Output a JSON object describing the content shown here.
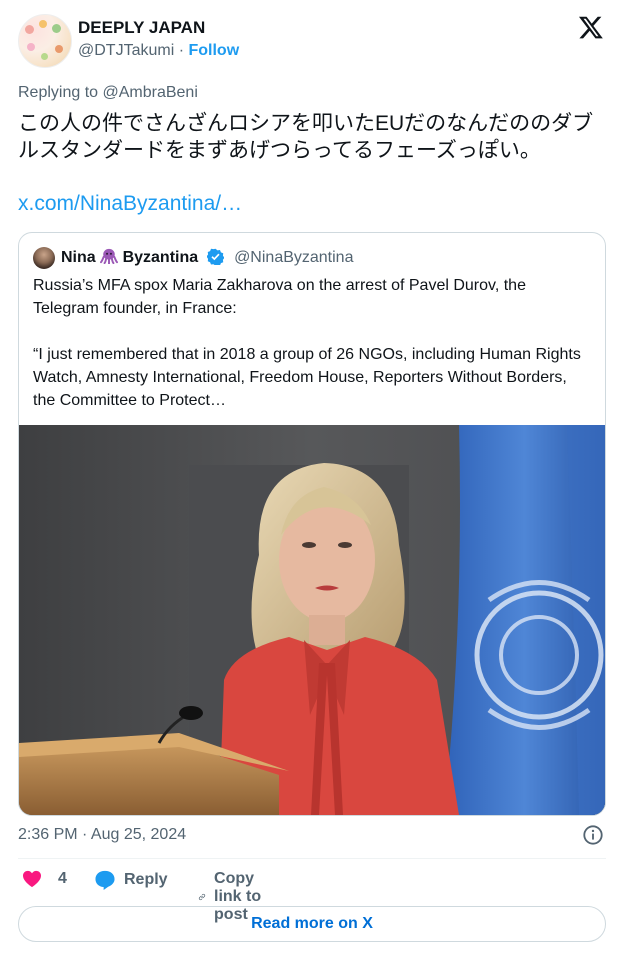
{
  "author": {
    "name": "DEEPLY JAPAN",
    "handle": "@DTJTakumi",
    "separator": "·",
    "follow_label": "Follow"
  },
  "replying_to": "Replying to @AmbraBeni",
  "tweet_text": "この人の件でさんざんロシアを叩いたEUだのなんだののダブルスタンダードをまずあげつらってるフェーズっぽい。",
  "tweet_link": "x.com/NinaByzantina/…",
  "quoted": {
    "name_first": "Nina",
    "name_last": "Byzantina",
    "handle": "@NinaByzantina",
    "paragraph1": "Russia’s MFA spox Maria Zakharova on the arrest of Pavel Durov, the Telegram founder, in France:",
    "paragraph2": "“I just remembered that in 2018 a group of 26 NGOs, including Human Rights Watch, Amnesty International, Freedom House, Reporters Without Borders, the Committee to Protect…"
  },
  "timestamp": "2:36 PM · Aug 25, 2024",
  "actions": {
    "like_count": "4",
    "reply_label": "Reply",
    "copy_label": "Copy link to post"
  },
  "read_more_label": "Read more on X",
  "colors": {
    "accent": "#1d9bf0",
    "like": "#f91880",
    "muted": "#536471"
  }
}
